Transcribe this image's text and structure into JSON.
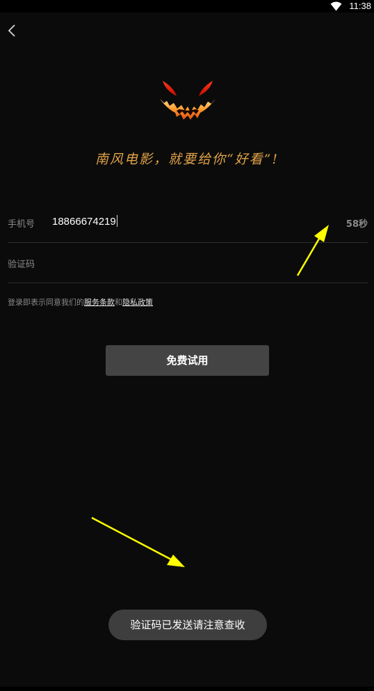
{
  "status_bar": {
    "time": "11:38",
    "icons": [
      "wifi-icon"
    ]
  },
  "header": {
    "back_icon": "chevron-left-icon"
  },
  "brand": {
    "logo_icon": "pumpkin-face-logo",
    "slogan": "南风电影，就要给你“好看”!",
    "slogan_color": "#e0a248"
  },
  "form": {
    "phone_label": "手机号",
    "phone_value": "18866674219",
    "countdown": "58秒",
    "code_label": "验证码",
    "code_value": ""
  },
  "agreement": {
    "prefix": "登录即表示同意我们的",
    "terms_link": "服务条款",
    "conjunction": "和",
    "privacy_link": "隐私政策"
  },
  "actions": {
    "trial_label": "免费试用"
  },
  "toast": {
    "message": "验证码已发送请注意查收"
  },
  "annotation_color": "#ffff00"
}
